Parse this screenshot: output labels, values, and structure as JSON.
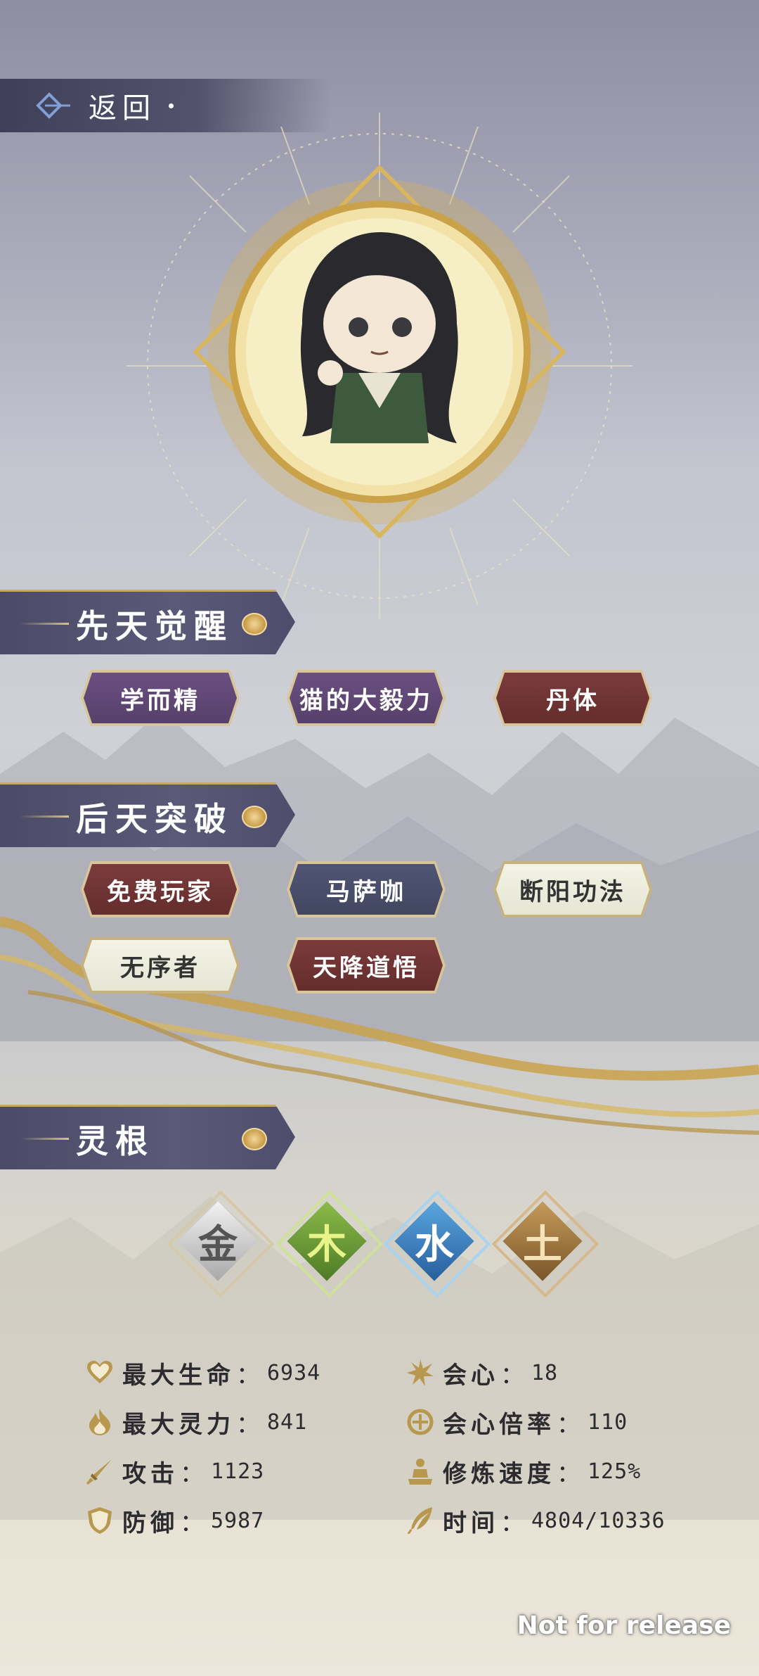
{
  "header": {
    "back_label": "返回"
  },
  "sections": {
    "innate": {
      "title": "先天觉醒"
    },
    "acquired": {
      "title": "后天突破"
    },
    "spirit_root": {
      "title": "灵根"
    }
  },
  "innate_tags": [
    {
      "label": "学而精",
      "style": "purple"
    },
    {
      "label": "猫的大毅力",
      "style": "purple"
    },
    {
      "label": "丹体",
      "style": "red"
    }
  ],
  "acquired_tags": [
    {
      "label": "免费玩家",
      "style": "red"
    },
    {
      "label": "马萨咖",
      "style": "navy"
    },
    {
      "label": "断阳功法",
      "style": "cream"
    },
    {
      "label": "无序者",
      "style": "cream"
    },
    {
      "label": "天降道悟",
      "style": "red"
    }
  ],
  "elements": [
    {
      "char": "金",
      "name": "metal",
      "color": "#bdbdbd"
    },
    {
      "char": "木",
      "name": "wood",
      "color": "#6f9a3a"
    },
    {
      "char": "水",
      "name": "water",
      "color": "#3a7fbf"
    },
    {
      "char": "土",
      "name": "earth",
      "color": "#9a7440"
    }
  ],
  "stats_left": [
    {
      "icon": "heart-icon",
      "label": "最大生命",
      "value": "6934"
    },
    {
      "icon": "flame-icon",
      "label": "最大灵力",
      "value": "841"
    },
    {
      "icon": "sword-icon",
      "label": "攻击",
      "value": "1123"
    },
    {
      "icon": "shield-icon",
      "label": "防御",
      "value": "5987"
    }
  ],
  "stats_right": [
    {
      "icon": "crit-burst-icon",
      "label": "会心",
      "value": "18"
    },
    {
      "icon": "target-icon",
      "label": "会心倍率",
      "value": "110"
    },
    {
      "icon": "meditation-icon",
      "label": "修炼速度",
      "value": "125%"
    },
    {
      "icon": "feather-icon",
      "label": "时间",
      "value": "4804/10336"
    }
  ],
  "watermark": "Not for release"
}
